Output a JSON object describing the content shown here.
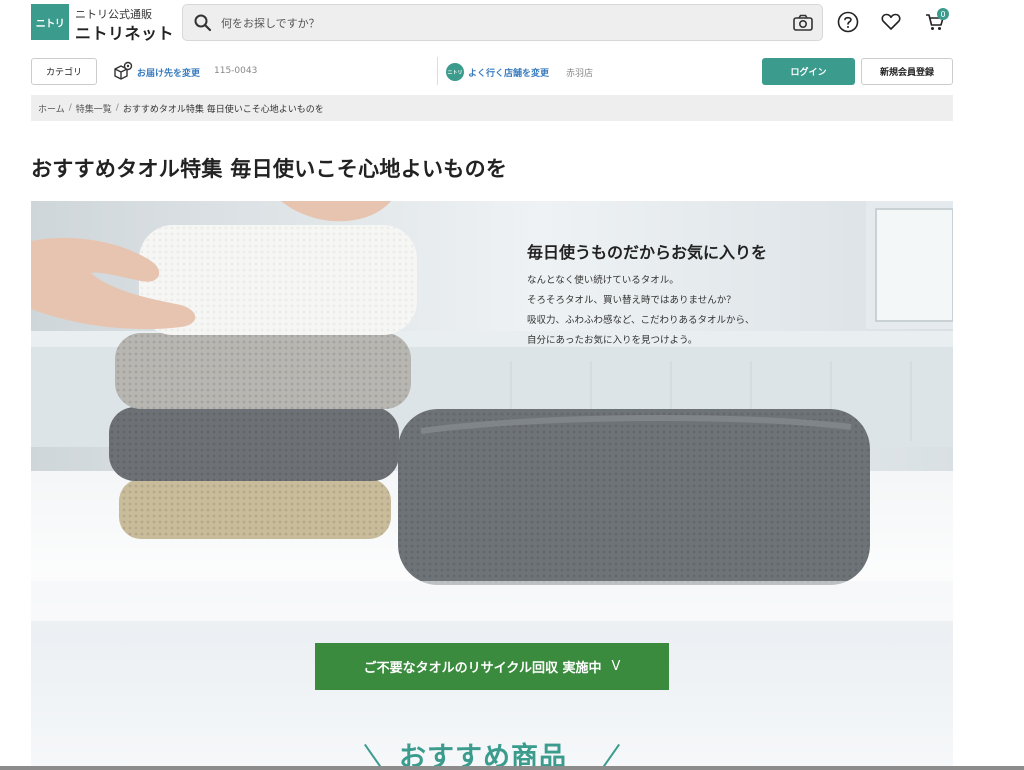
{
  "header": {
    "logo_mark": "ニトリ",
    "logo_sub": "ニトリ公式通販",
    "logo_main": "ニトリネット",
    "search_placeholder": "何をお探しですか？",
    "cart_count": "0",
    "icons": [
      "search-icon",
      "camera-icon",
      "help-icon",
      "heart-icon",
      "cart-icon"
    ]
  },
  "subbar": {
    "category_label": "カテゴリ",
    "delivery_link": "お届け先を変更",
    "delivery_zip": "115-0043",
    "store_mark": "ニトリ",
    "store_link": "よく行く店舗を変更",
    "store_name": "赤羽店",
    "login_label": "ログイン",
    "register_label": "新規会員登録"
  },
  "breadcrumb": {
    "items": [
      "ホーム",
      "特集一覧"
    ],
    "current": "おすすめタオル特集 毎日使いこそ心地よいものを"
  },
  "page_title": "おすすめタオル特集 毎日使いこそ心地よいものを",
  "hero": {
    "heading": "毎日使うものだからお気に入りを",
    "lines": [
      "なんとなく使い続けているタオル。",
      "そろそろタオル、買い替え時ではありませんか？",
      "吸収力、ふわふわ感など、こだわりあるタオルから、",
      "自分にあったお気に入りを見つけよう。"
    ]
  },
  "recycle_banner": {
    "label": "ご不要なタオルのリサイクル回収 実施中",
    "chevron": "V"
  },
  "recommended_title": "おすすめ商品",
  "colors": {
    "brand": "#3b9b8d",
    "banner_green": "#3b8b3f",
    "link_blue": "#3b7dbf"
  }
}
